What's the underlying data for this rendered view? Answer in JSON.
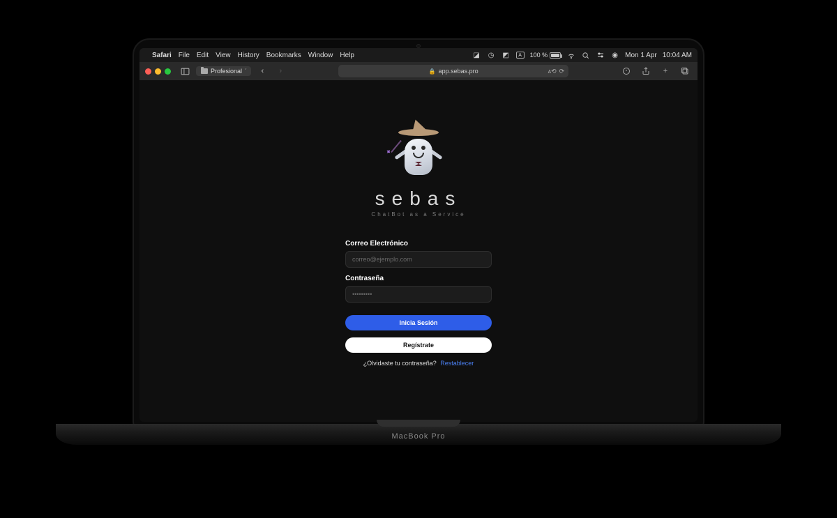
{
  "menubar": {
    "app": "Safari",
    "items": [
      "File",
      "Edit",
      "View",
      "History",
      "Bookmarks",
      "Window",
      "Help"
    ],
    "battery_text": "100 %",
    "date": "Mon 1 Apr",
    "time": "10:04 AM"
  },
  "browser": {
    "tab_group": "Profesional",
    "url_host": "app.sebas.pro"
  },
  "brand": {
    "name": "sebas",
    "tagline": "ChatBot as a Service"
  },
  "form": {
    "email_label": "Correo Electrónico",
    "email_placeholder": "correo@ejemplo.com",
    "password_label": "Contraseña",
    "password_placeholder": "•••••••••",
    "login_button": "Inicia Sesión",
    "register_button": "Regístrate",
    "forgot_text": "¿Olvidaste tu contraseña?",
    "reset_link": "Restablecer"
  },
  "laptop": {
    "brand": "MacBook Pro"
  }
}
